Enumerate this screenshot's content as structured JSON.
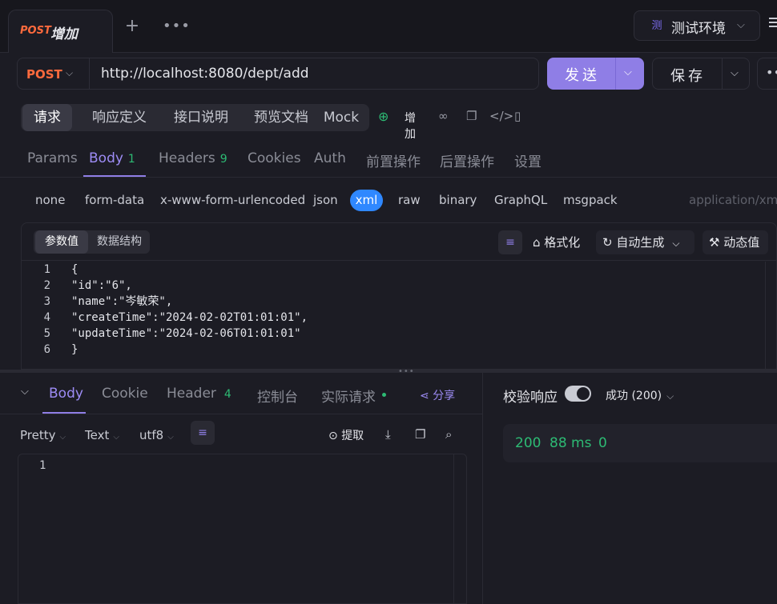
{
  "tab": {
    "method": "POST",
    "name": "增加"
  },
  "env": {
    "icon_char": "测",
    "label": "测试环境"
  },
  "request": {
    "method": "POST",
    "url": "http://localhost:8080/dept/add",
    "send_label": "发送",
    "save_label": "保存"
  },
  "segments": [
    "请求",
    "响应定义",
    "接口说明",
    "预览文档",
    "Mock"
  ],
  "api_name": "增加",
  "req_tabs": {
    "params": "Params",
    "body": "Body",
    "body_count": "1",
    "headers": "Headers",
    "headers_count": "9",
    "cookies": "Cookies",
    "auth": "Auth",
    "pre": "前置操作",
    "post": "后置操作",
    "settings": "设置"
  },
  "body_types": [
    "none",
    "form-data",
    "x-www-form-urlencoded",
    "json",
    "xml",
    "raw",
    "binary",
    "GraphQL",
    "msgpack"
  ],
  "content_type": "application/xml",
  "editor": {
    "seg_params": "参数值",
    "seg_schema": "数据结构",
    "format": "格式化",
    "autogen": "自动生成",
    "dynamic": "动态值",
    "lines": [
      {
        "n": "1",
        "text": "{"
      },
      {
        "n": "2",
        "text": "\"id\":\"6\","
      },
      {
        "n": "3",
        "text": "\"name\":\"岑敏荣\","
      },
      {
        "n": "4",
        "text": "\"createTime\":\"2024-02-02T01:01:01\","
      },
      {
        "n": "5",
        "text": "\"updateTime\":\"2024-02-06T01:01:01\""
      },
      {
        "n": "6",
        "text": "}"
      }
    ]
  },
  "response": {
    "tabs": {
      "body": "Body",
      "cookie": "Cookie",
      "header": "Header",
      "header_count": "4",
      "console": "控制台",
      "actual": "实际请求"
    },
    "share": "分享",
    "pretty": "Pretty",
    "text": "Text",
    "encoding": "utf8",
    "extract": "提取",
    "line1": "1"
  },
  "validation": {
    "title": "校验响应",
    "status": "成功 (200)",
    "code": "200",
    "time": "88 ms",
    "size": "0"
  },
  "colors": {
    "accent": "#8f7ee6",
    "post": "#ff6a3d",
    "success": "#2dbb74",
    "xml_pill": "#2f88ff"
  }
}
